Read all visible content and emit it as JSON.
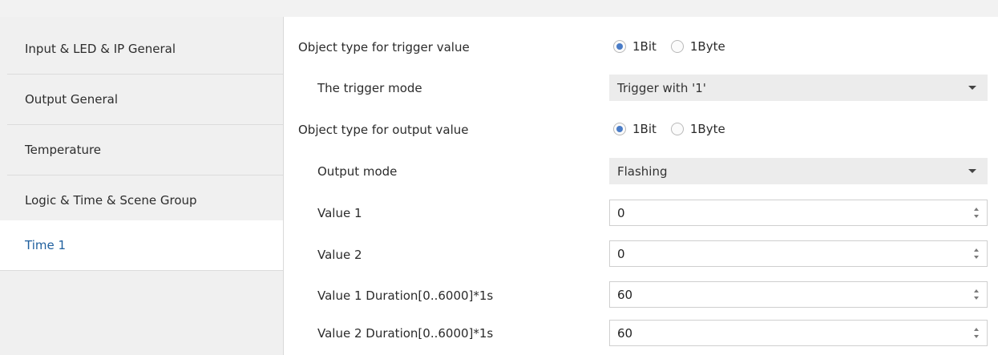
{
  "sidebar": {
    "items": [
      {
        "label": "Input & LED & IP General"
      },
      {
        "label": "Output General"
      },
      {
        "label": "Temperature"
      },
      {
        "label": "Logic & Time & Scene Group"
      },
      {
        "label": "Time 1",
        "active": true
      }
    ]
  },
  "params": {
    "trigger_object_type": {
      "label": "Object type for trigger value",
      "options": [
        "1Bit",
        "1Byte"
      ],
      "selected": "1Bit"
    },
    "trigger_mode": {
      "label": "The trigger mode",
      "value": "Trigger with '1'"
    },
    "output_object_type": {
      "label": "Object type for output value",
      "options": [
        "1Bit",
        "1Byte"
      ],
      "selected": "1Bit"
    },
    "output_mode": {
      "label": "Output mode",
      "value": "Flashing"
    },
    "value1": {
      "label": "Value 1",
      "value": "0"
    },
    "value2": {
      "label": "Value 2",
      "value": "0"
    },
    "value1_duration": {
      "label": "Value 1 Duration[0..6000]*1s",
      "value": "60"
    },
    "value2_duration": {
      "label": "Value 2 Duration[0..6000]*1s",
      "value": "60"
    }
  },
  "colors": {
    "active_nav_text": "#1f5f9e",
    "radio_checked": "#4a7cc7"
  }
}
